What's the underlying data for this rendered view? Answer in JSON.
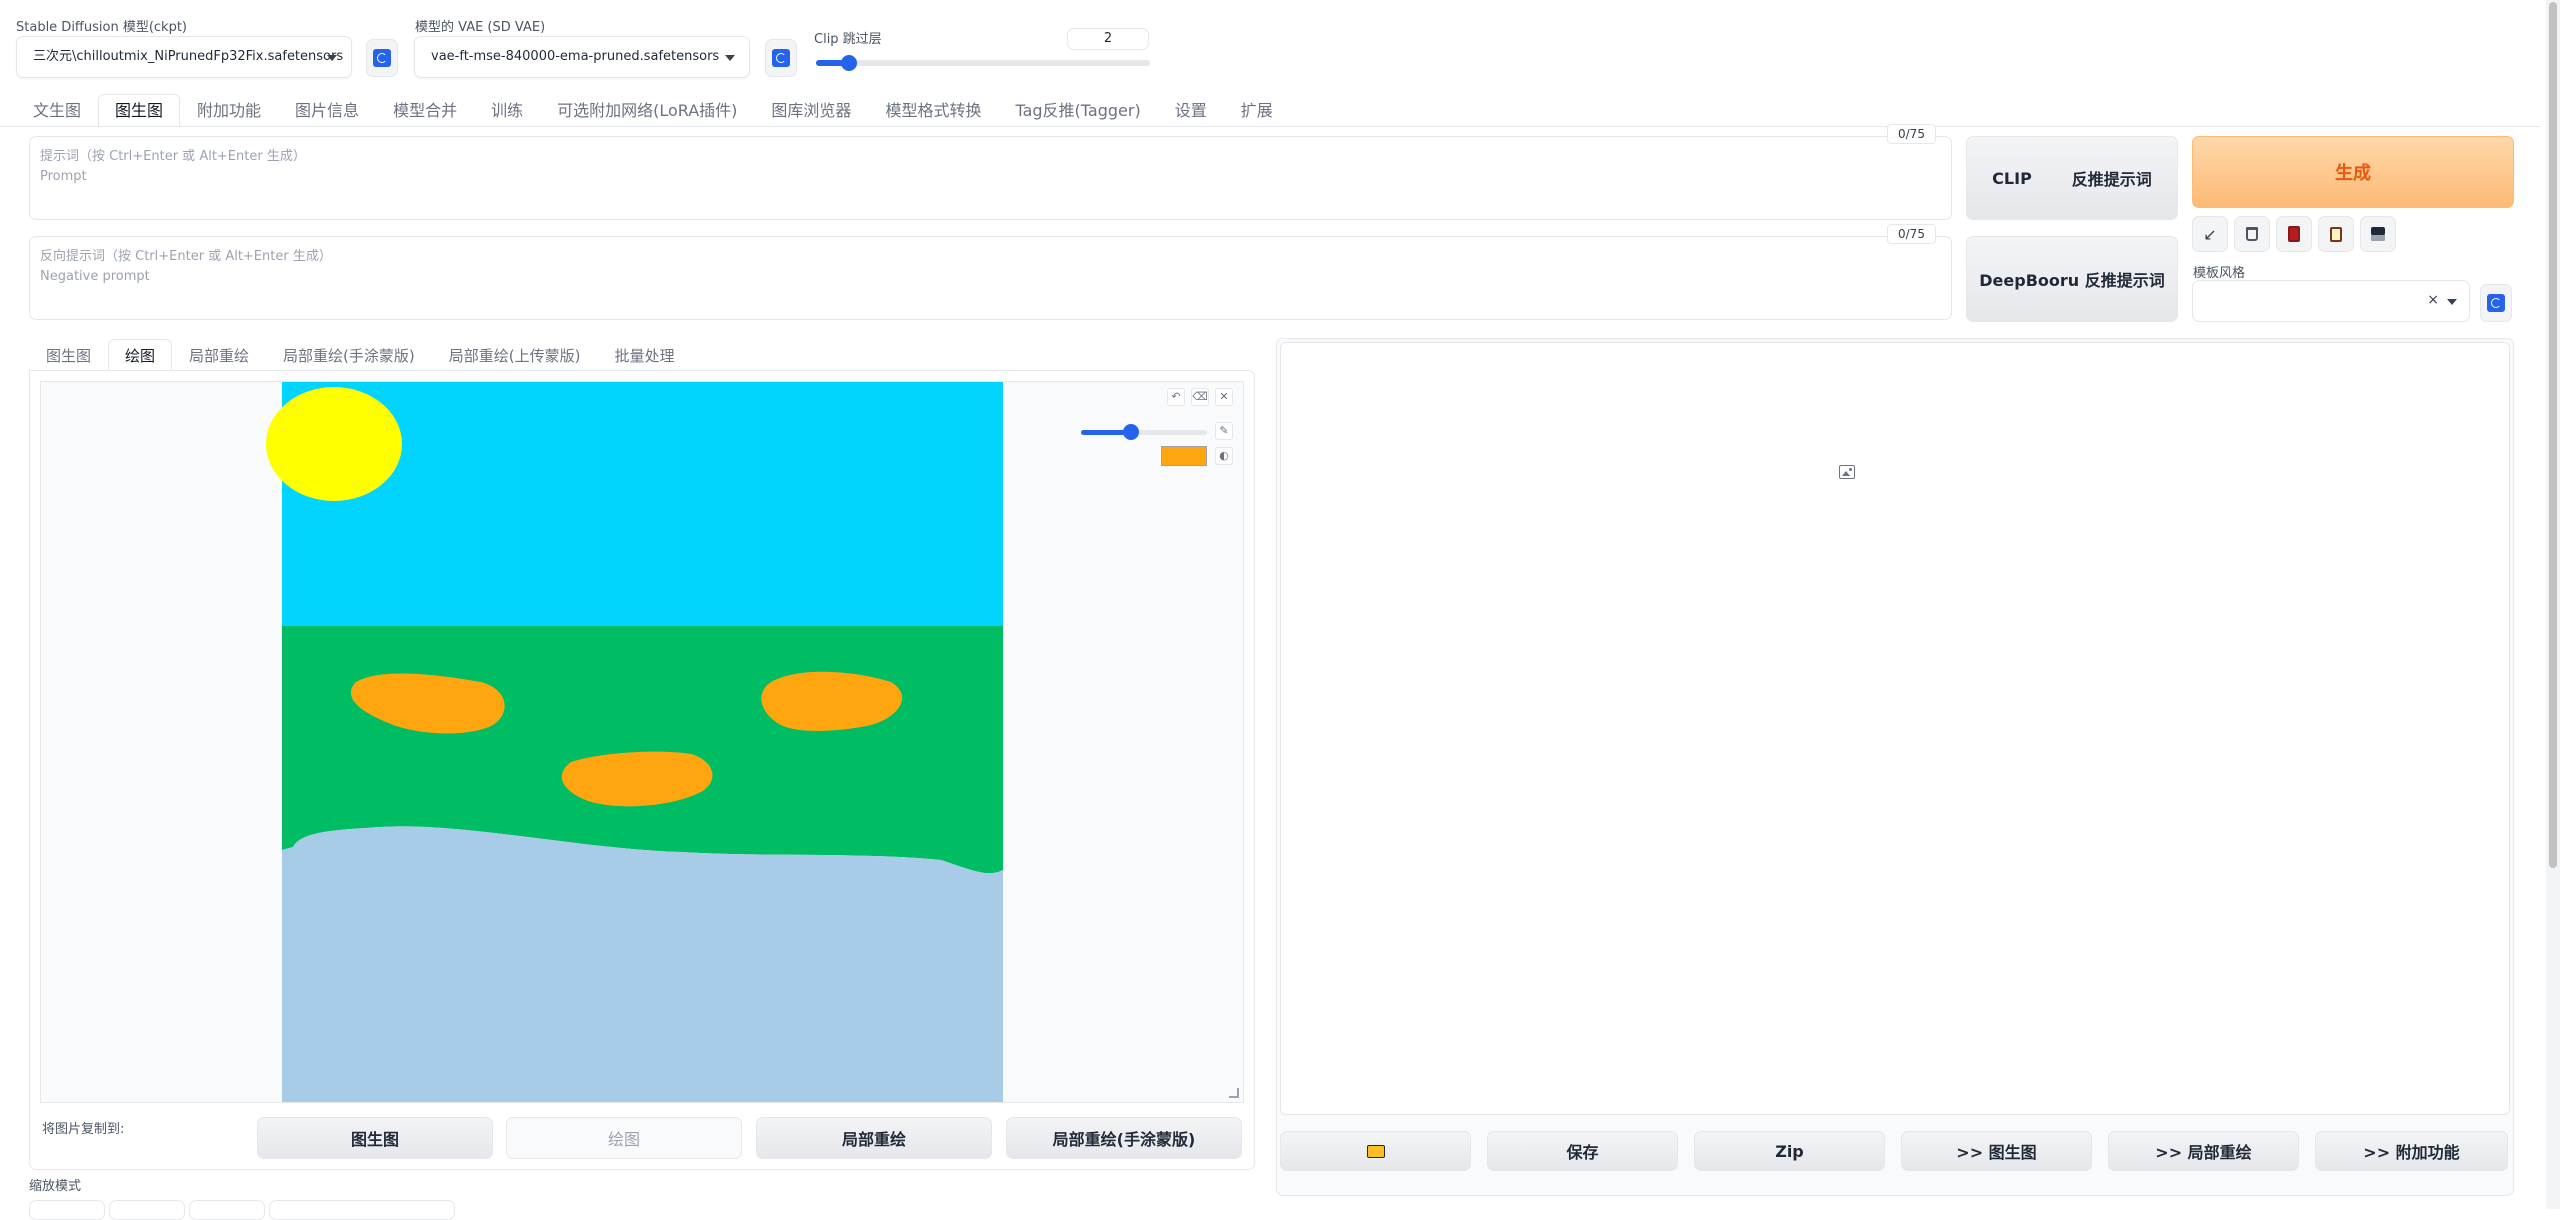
{
  "top": {
    "model_label": "Stable Diffusion 模型(ckpt)",
    "model_value": "三次元\\chilloutmix_NiPrunedFp32Fix.safetensors",
    "vae_label": "模型的 VAE (SD VAE)",
    "vae_value": "vae-ft-mse-840000-ema-pruned.safetensors",
    "clip_label": "Clip 跳过层",
    "clip_value": "2",
    "clip_fraction": 0.1
  },
  "main_tabs": [
    "文生图",
    "图生图",
    "附加功能",
    "图片信息",
    "模型合并",
    "训练",
    "可选附加网络(LoRA插件)",
    "图库浏览器",
    "模型格式转换",
    "Tag反推(Tagger)",
    "设置",
    "扩展"
  ],
  "main_tabs_active": 1,
  "prompt": {
    "placeholder_1": "提示词（按 Ctrl+Enter 或 Alt+Enter 生成）",
    "placeholder_2": "Prompt",
    "counter": "0/75"
  },
  "negative": {
    "placeholder_1": "反向提示词（按 Ctrl+Enter 或 Alt+Enter 生成）",
    "placeholder_2": "Negative prompt",
    "counter": "0/75"
  },
  "interrogate": {
    "clip_a": "CLIP",
    "clip_b": "反推提示词",
    "deepbooru": "DeepBooru 反推提示词"
  },
  "generate_label": "生成",
  "style": {
    "label": "模板风格",
    "clear": "×"
  },
  "tool_icons": [
    "arrow-icon",
    "trash-icon",
    "red-card-icon",
    "clipboard-icon",
    "save-disk-icon"
  ],
  "sub_tabs": [
    "图生图",
    "绘图",
    "局部重绘",
    "局部重绘(手涂蒙版)",
    "局部重绘(上传蒙版)",
    "批量处理"
  ],
  "sub_tabs_active": 1,
  "sketch": {
    "brush_fraction": 0.4,
    "brush_color": "#ffa50f",
    "sky_color": "#00d4ff",
    "grass_color": "#00bc62",
    "water_color": "#a8cbe8",
    "sun_color": "#ffff00"
  },
  "copy": {
    "label": "将图片复制到:",
    "buttons": [
      "图生图",
      "绘图",
      "局部重绘",
      "局部重绘(手涂蒙版)"
    ]
  },
  "resize_label": "缩放模式",
  "output_buttons": [
    "保存",
    "Zip",
    ">> 图生图",
    ">> 局部重绘",
    ">> 附加功能"
  ],
  "colors": {
    "accent": "#2563eb",
    "generate": "#ea580c"
  }
}
